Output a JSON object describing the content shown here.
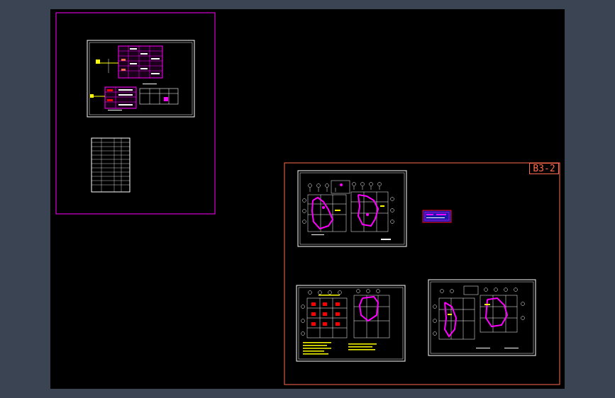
{
  "app": {
    "background": "#3b4453",
    "canvas_background": "#000000"
  },
  "drawing": {
    "group_label": "B3-2",
    "colors": {
      "magenta": "#ff00ff",
      "white": "#ffffff",
      "orange": "#ff6a4d",
      "yellow": "#ffff00",
      "red": "#ff0000",
      "blue": "#2a2aff",
      "cyan": "#00ffff"
    },
    "sheets": [
      {
        "name": "sheet-system-diagram"
      },
      {
        "name": "sheet-material-table"
      },
      {
        "name": "sheet-floor-plan-1"
      },
      {
        "name": "sheet-floor-plan-2"
      },
      {
        "name": "sheet-floor-plan-3"
      }
    ]
  }
}
